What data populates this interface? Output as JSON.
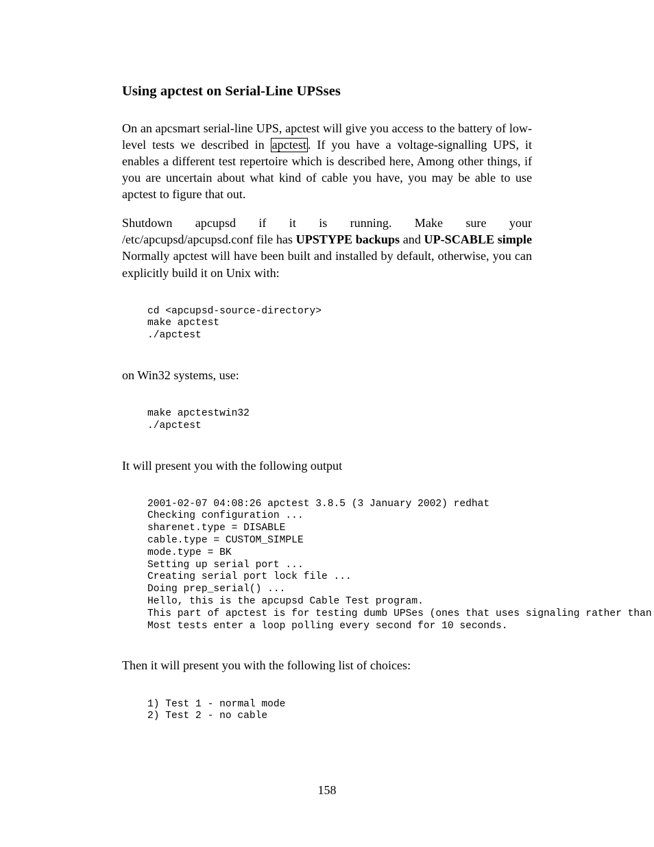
{
  "heading": "Using apctest on Serial-Line UPSses",
  "para1": {
    "t1": "On an apcsmart serial-line UPS, apctest will give you access to the battery of low-level tests we described in ",
    "link": "apctest",
    "t2": ". If you have a voltage-signalling UPS, it enables a different test repertoire which is described here, Among other things, if you are uncertain about what kind of cable you have, you may be able to use apctest to figure that out."
  },
  "para2": {
    "line1": [
      "Shutdown",
      "apcupsd",
      "if",
      "it",
      "is",
      "running.",
      "Make",
      "sure",
      "your"
    ],
    "t1": "/etc/apcupsd/apcupsd.conf  file  has  ",
    "b1": "UPSTYPE  backups",
    "t2": "  and  ",
    "b2": "UP-SCABLE simple",
    "t3": " Normally apctest will have been built and installed by default, otherwise, you can explicitly build it on Unix with:"
  },
  "code1": "cd <apcupsd-source-directory>\nmake apctest\n./apctest",
  "body1": "on Win32 systems, use:",
  "code2": "make apctestwin32\n./apctest",
  "body2": "It will present you with the following output",
  "code3": "2001-02-07 04:08:26 apctest 3.8.5 (3 January 2002) redhat\nChecking configuration ...\nsharenet.type = DISABLE\ncable.type = CUSTOM_SIMPLE\nmode.type = BK\nSetting up serial port ...\nCreating serial port lock file ...\nDoing prep_serial() ...\nHello, this is the apcupsd Cable Test program.\nThis part of apctest is for testing dumb UPSes (ones that uses signaling rather than commands.\nMost tests enter a loop polling every second for 10 seconds.",
  "body3": "Then it will present you with the following list of choices:",
  "code4": "1) Test 1 - normal mode\n2) Test 2 - no cable",
  "page_number": "158"
}
